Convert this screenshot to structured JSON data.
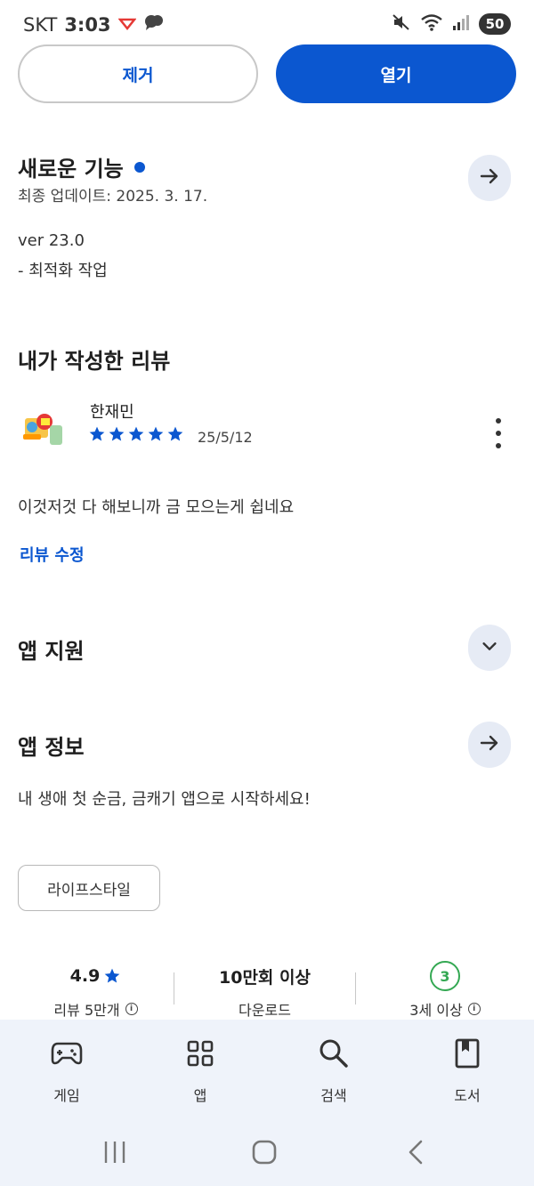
{
  "status_bar": {
    "carrier": "SKT",
    "time": "3:03",
    "battery": "50"
  },
  "actions": {
    "remove_label": "제거",
    "open_label": "열기"
  },
  "whats_new": {
    "title": "새로운 기능",
    "updated": "최종 업데이트: 2025. 3. 17.",
    "version": "ver 23.0",
    "notes": "- 최적화 작업"
  },
  "my_review": {
    "title": "내가 작성한 리뷰",
    "reviewer": "한재민",
    "rating": 5,
    "date": "25/5/12",
    "text": "이것저것 다 해보니까 금 모으는게 쉽네요",
    "edit_label": "리뷰 수정"
  },
  "app_support": {
    "title": "앱 지원"
  },
  "app_info": {
    "title": "앱 정보",
    "description": "내 생애 첫 순금, 금캐기 앱으로 시작하세요!",
    "category": "라이프스타일"
  },
  "stats": {
    "rating": "4.9",
    "reviews": "리뷰 5만개",
    "downloads": "10만회 이상",
    "downloads_label": "다운로드",
    "age": "3",
    "age_label": "3세 이상"
  },
  "bottom_nav": {
    "items": [
      {
        "label": "게임"
      },
      {
        "label": "앱"
      },
      {
        "label": "검색"
      },
      {
        "label": "도서"
      }
    ]
  },
  "colors": {
    "accent": "#0b57d0",
    "star": "#0b57d0",
    "age_badge": "#34a853",
    "nav_bg": "#eff3fa"
  }
}
